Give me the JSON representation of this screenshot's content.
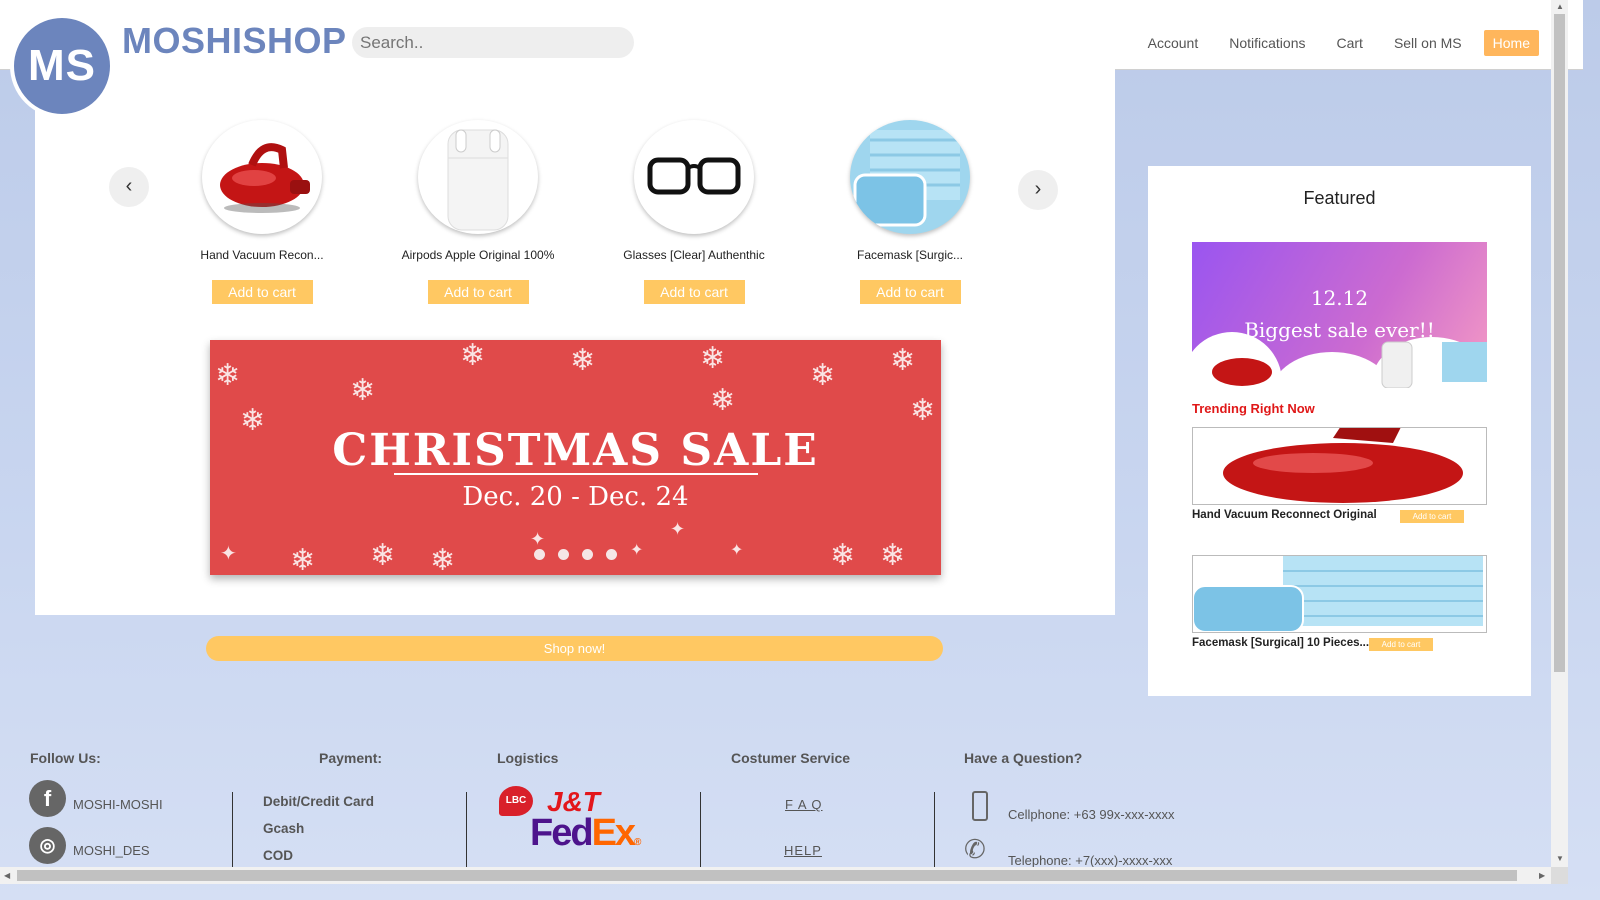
{
  "brand": {
    "logo_initials": "MS",
    "name": "MOSHISHOP"
  },
  "search": {
    "placeholder": "Search.."
  },
  "nav": {
    "account": "Account",
    "notifications": "Notifications",
    "cart": "Cart",
    "sell": "Sell on MS",
    "home": "Home"
  },
  "carousel": {
    "prev": "‹",
    "next": "›",
    "products": [
      {
        "name": "Hand Vacuum Recon...",
        "button": "Add to cart"
      },
      {
        "name": "Airpods Apple Original 100%",
        "button": "Add to cart"
      },
      {
        "name": "Glasses [Clear] Authenthic",
        "button": "Add to cart"
      },
      {
        "name": "Facemask [Surgic...",
        "button": "Add to cart"
      }
    ]
  },
  "banner": {
    "title": "CHRISTMAS SALE",
    "dates": "Dec. 20 - Dec. 24"
  },
  "shop_now": "Shop now!",
  "featured": {
    "title": "Featured",
    "promo_line1": "12.12",
    "promo_line2": "Biggest sale ever!!",
    "trending_label": "Trending Right Now",
    "items": [
      {
        "name": "Hand Vacuum Reconnect Original",
        "button": "Add to cart"
      },
      {
        "name": "Facemask [Surgical] 10 Pieces...",
        "button": "Add to cart"
      }
    ]
  },
  "footer": {
    "follow": {
      "heading": "Follow Us:",
      "facebook": "MOSHI-MOSHI",
      "instagram": "MOSHI_DES"
    },
    "payment": {
      "heading": "Payment:",
      "methods": [
        "Debit/Credit Card",
        "Gcash",
        "COD"
      ]
    },
    "logistics": {
      "heading": "Logistics",
      "carriers": [
        "LBC",
        "J&T",
        "FedEx"
      ]
    },
    "service": {
      "heading": "Costumer Service",
      "faq": "F A Q",
      "help": "HELP"
    },
    "question": {
      "heading": "Have a Question?",
      "cellphone": "Cellphone: +63 99x-xxx-xxxx",
      "telephone": "Telephone: +7(xxx)-xxxx-xxx"
    }
  },
  "colors": {
    "brand": "#6c85bd",
    "accent": "#ffc862",
    "home": "#ffb65c",
    "banner": "#e04a4a",
    "trending": "#e01818"
  }
}
